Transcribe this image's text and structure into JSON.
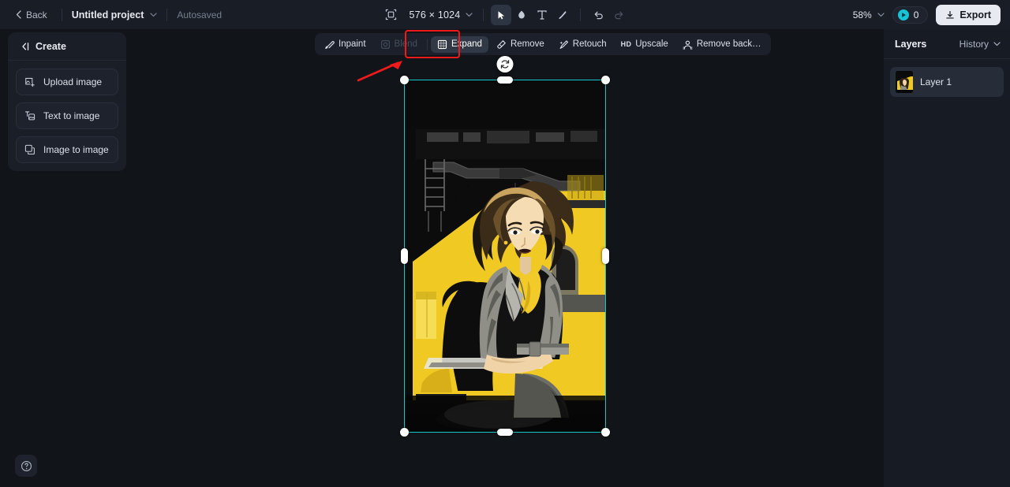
{
  "topbar": {
    "back_label": "Back",
    "project_name": "Untitled project",
    "autosave_label": "Autosaved",
    "crop_icon": "crop-resize-icon",
    "dimensions": "576 × 1024",
    "tools": [
      {
        "name": "select-tool",
        "icon": "cursor-icon",
        "active": true
      },
      {
        "name": "hand-tool",
        "icon": "hand-icon",
        "active": false
      },
      {
        "name": "text-tool",
        "icon": "text-icon",
        "active": false
      },
      {
        "name": "brush-tool",
        "icon": "brush-icon",
        "active": false
      }
    ],
    "undo_icon": "undo-icon",
    "redo_icon": "redo-icon",
    "zoom_level": "58%",
    "credits": "0",
    "export_label": "Export"
  },
  "sidebar": {
    "header_label": "Create",
    "collapse_icon": "collapse-left-icon",
    "items": [
      {
        "label": "Upload image",
        "icon": "upload-image-icon"
      },
      {
        "label": "Text to image",
        "icon": "text-to-image-icon"
      },
      {
        "label": "Image to image",
        "icon": "image-to-image-icon"
      }
    ],
    "help_icon": "question-mark-icon"
  },
  "floating_toolbar": {
    "items": [
      {
        "label": "Inpaint",
        "icon": "inpaint-icon",
        "state": "normal"
      },
      {
        "label": "Blend",
        "icon": "blend-icon",
        "state": "disabled"
      },
      {
        "label": "Expand",
        "icon": "expand-icon",
        "state": "selected"
      },
      {
        "label": "Remove",
        "icon": "remove-icon",
        "state": "normal"
      },
      {
        "label": "Retouch",
        "icon": "retouch-icon",
        "state": "normal"
      },
      {
        "label": "Upscale",
        "icon": "hd-icon",
        "state": "normal"
      },
      {
        "label": "Remove back…",
        "icon": "remove-background-icon",
        "state": "normal"
      }
    ]
  },
  "annotation": {
    "highlight_color": "#ef1b1b",
    "target": "Expand"
  },
  "canvas": {
    "selection_color": "#18c8c8",
    "rotate_icon": "rotate-icon",
    "background": "#111419",
    "artwork_colors": {
      "yellow": "#f2cb2b",
      "dark": "#0c0c0c",
      "grey": "#8a8a84",
      "skin": "#f0d4a8"
    }
  },
  "right_panel": {
    "title": "Layers",
    "history_label": "History",
    "history_icon": "chevron-down-icon",
    "layers": [
      {
        "label": "Layer 1",
        "thumbnail": "artwork-thumbnail"
      }
    ]
  }
}
